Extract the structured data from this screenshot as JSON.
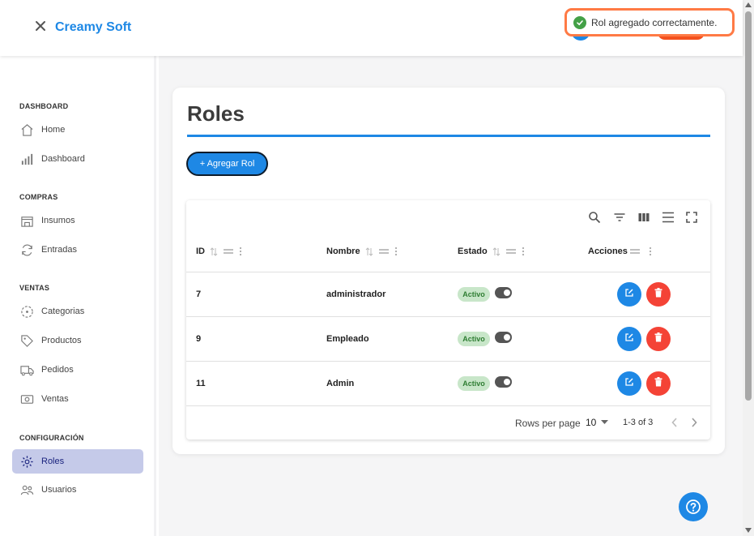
{
  "app": {
    "brand": "Creamy Soft"
  },
  "toast": {
    "message": "Rol agregado correctamente."
  },
  "sidebar": {
    "sections": [
      {
        "title": "DASHBOARD",
        "items": [
          {
            "label": "Home",
            "icon": "home-icon"
          },
          {
            "label": "Dashboard",
            "icon": "bar-chart-icon"
          }
        ]
      },
      {
        "title": "COMPRAS",
        "items": [
          {
            "label": "Insumos",
            "icon": "store-icon"
          },
          {
            "label": "Entradas",
            "icon": "refresh-icon"
          }
        ]
      },
      {
        "title": "VENTAS",
        "items": [
          {
            "label": "Categorias",
            "icon": "category-icon"
          },
          {
            "label": "Productos",
            "icon": "tag-icon"
          },
          {
            "label": "Pedidos",
            "icon": "truck-icon"
          },
          {
            "label": "Ventas",
            "icon": "money-icon"
          }
        ]
      },
      {
        "title": "CONFIGURACIÓN",
        "items": [
          {
            "label": "Roles",
            "icon": "gear-icon",
            "active": true
          },
          {
            "label": "Usuarios",
            "icon": "users-icon"
          }
        ]
      }
    ]
  },
  "page": {
    "title": "Roles",
    "add_button": "+ Agregar Rol"
  },
  "table": {
    "columns": [
      "ID",
      "Nombre",
      "Estado",
      "Acciones"
    ],
    "rows": [
      {
        "id": "7",
        "nombre": "administrador",
        "estado": "Activo"
      },
      {
        "id": "9",
        "nombre": "Empleado",
        "estado": "Activo"
      },
      {
        "id": "11",
        "nombre": "Admin",
        "estado": "Activo"
      }
    ],
    "footer": {
      "rows_per_page_label": "Rows per page",
      "rows_per_page": "10",
      "range": "1-3 of 3"
    }
  },
  "colors": {
    "accent": "#1e88e5",
    "danger": "#f44336",
    "active_nav": "#c5cae9",
    "toast_border": "#ff7a45"
  }
}
